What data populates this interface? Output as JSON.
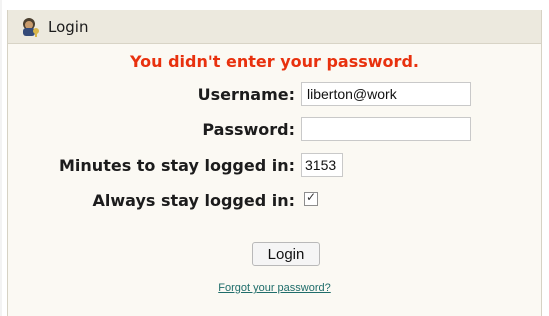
{
  "title": "Login",
  "title_icon": "user-keys-icon",
  "error_message": "You didn't enter your password.",
  "fields": {
    "username": {
      "label": "Username:",
      "value": "liberton@work"
    },
    "password": {
      "label": "Password:",
      "value": ""
    },
    "minutes": {
      "label": "Minutes to stay logged in:",
      "value": "3153"
    },
    "always": {
      "label": "Always stay logged in:",
      "checked": true
    }
  },
  "login_button": "Login",
  "forgot_link": "Forgot your password?",
  "colors": {
    "error": "#e8310e",
    "link": "#1f6d6a",
    "panel_bg": "#fbf9f3",
    "titlebar_bg": "#ece9de"
  }
}
